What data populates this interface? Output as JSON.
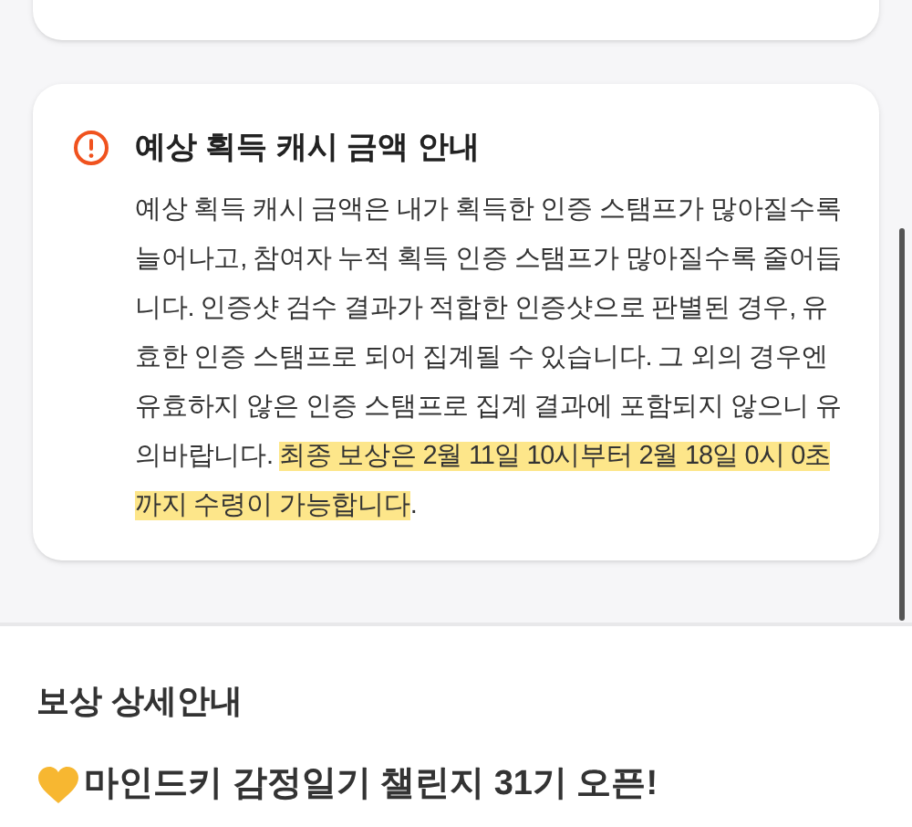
{
  "notice": {
    "title": "예상 획득 캐시 금액 안내",
    "body": "예상 획득 캐시 금액은 내가 획득한 인증 스탬프가 많아질수록 늘어나고, 참여자 누적 획득 인증 스탬프가 많아질수록 줄어듭니다. 인증샷 검수 결과가 적합한 인증샷으로 판별된 경우, 유효한 인증 스탬프로 되어 집계될 수 있습니다. 그 외의 경우엔 유효하지 않은 인증 스탬프로 집계 결과에 포함되지 않으니 유의바랍니다. ",
    "highlight": "최종 보상은 2월 11일 10시부터 2월 18일 0시 0초까지 수령이 가능합니다",
    "tail": "."
  },
  "reward_details": {
    "heading": "보상 상세안내",
    "announcement": "마인드키 감정일기 챌린지 31기 오픈!"
  }
}
